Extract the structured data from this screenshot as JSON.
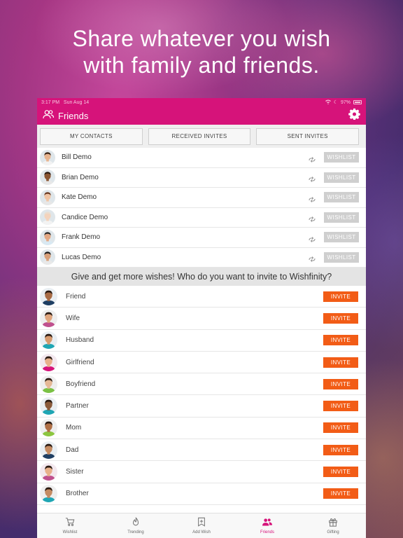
{
  "headline": {
    "line1": "Share whatever you wish",
    "line2": "with family and friends."
  },
  "status_bar": {
    "time": "3:17 PM",
    "date": "Sun Aug 14",
    "battery": "97%"
  },
  "header": {
    "title": "Friends",
    "icon": "friends-icon",
    "settings_icon": "gear-icon"
  },
  "tabs": [
    {
      "label": "MY CONTACTS"
    },
    {
      "label": "RECEIVED INVITES"
    },
    {
      "label": "SENT INVITES"
    }
  ],
  "contacts": [
    {
      "name": "Bill Demo",
      "action": "WISHLIST",
      "skin": "#e7b48f",
      "hair": "#3b2416",
      "shirt": "#f3f3f3"
    },
    {
      "name": "Brian Demo",
      "action": "WISHLIST",
      "skin": "#8a5633",
      "hair": "#2a1a10",
      "shirt": "#e8e8e8"
    },
    {
      "name": "Kate Demo",
      "action": "WISHLIST",
      "skin": "#f0c4a4",
      "hair": "#6a3a22",
      "shirt": "#e7e7e7"
    },
    {
      "name": "Candice Demo",
      "action": "WISHLIST",
      "skin": "#f3d3bd",
      "hair": "#e9ddd0",
      "shirt": "#f3f3f3"
    },
    {
      "name": "Frank Demo",
      "action": "WISHLIST",
      "skin": "#e3a884",
      "hair": "#2b2b2b",
      "shirt": "#d9e9f3"
    },
    {
      "name": "Lucas Demo",
      "action": "WISHLIST",
      "skin": "#d8a07a",
      "hair": "#1e1e1e",
      "shirt": "#e9e9e9"
    }
  ],
  "invite_banner": "Give and get more wishes! Who do you want to invite to Wishfinity?",
  "invite_list": [
    {
      "label": "Friend",
      "action": "INVITE",
      "bg": "#e9eef2",
      "skin": "#a86b45",
      "shirt": "#1f3f63"
    },
    {
      "label": "Wife",
      "action": "INVITE",
      "bg": "#eeeeee",
      "skin": "#e0a67e",
      "shirt": "#c0508e"
    },
    {
      "label": "Husband",
      "action": "INVITE",
      "bg": "#e9eef2",
      "skin": "#d69a6e",
      "shirt": "#1fa6b4"
    },
    {
      "label": "Girlfriend",
      "action": "INVITE",
      "bg": "#f3e8ee",
      "skin": "#e8b08a",
      "shirt": "#d6137a"
    },
    {
      "label": "Boyfriend",
      "action": "INVITE",
      "bg": "#eeeeee",
      "skin": "#e5b896",
      "shirt": "#7ac143"
    },
    {
      "label": "Partner",
      "action": "INVITE",
      "bg": "#e9eef2",
      "skin": "#8a5a3a",
      "shirt": "#1fa6b4"
    },
    {
      "label": "Mom",
      "action": "INVITE",
      "bg": "#eeeeee",
      "skin": "#b07046",
      "shirt": "#8cc63f"
    },
    {
      "label": "Dad",
      "action": "INVITE",
      "bg": "#e9eef2",
      "skin": "#c48b62",
      "shirt": "#1f3f63"
    },
    {
      "label": "Sister",
      "action": "INVITE",
      "bg": "#f3e8ee",
      "skin": "#e8b08a",
      "shirt": "#c0508e"
    },
    {
      "label": "Brother",
      "action": "INVITE",
      "bg": "#eeeeee",
      "skin": "#c48b62",
      "shirt": "#1fa6b4"
    }
  ],
  "tabbar": [
    {
      "label": "Wishlist",
      "icon": "cart-icon",
      "active": false
    },
    {
      "label": "Trending",
      "icon": "flame-icon",
      "active": false
    },
    {
      "label": "Add Wish",
      "icon": "add-wish-icon",
      "active": false
    },
    {
      "label": "Friends",
      "icon": "friends-icon",
      "active": true
    },
    {
      "label": "Gifting",
      "icon": "gift-icon",
      "active": false
    }
  ],
  "colors": {
    "brand": "#d6137a",
    "invite": "#f25c16",
    "wishlist_disabled": "#cfcfcf"
  }
}
